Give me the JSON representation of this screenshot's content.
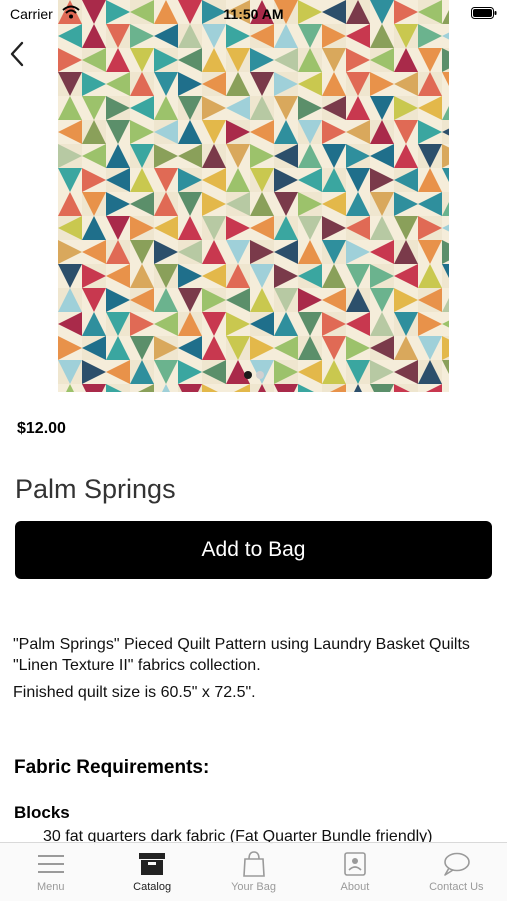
{
  "status_bar": {
    "carrier": "Carrier",
    "time": "11:50 AM"
  },
  "carousel": {
    "page_count": 2,
    "current_page": 1
  },
  "product": {
    "price": "$12.00",
    "title": "Palm Springs",
    "add_to_bag_label": "Add to Bag",
    "description": [
      "\"Palm Springs\" Pieced Quilt Pattern using Laundry Basket Quilts \"Linen Texture II\" fabrics collection.",
      "Finished quilt size is 60.5\" x 72.5\"."
    ],
    "fabric_requirements_heading": "Fabric Requirements:",
    "blocks_heading": "Blocks",
    "blocks_item": "30 fat quarters dark fabric (Fat Quarter Bundle friendly)"
  },
  "tab_bar": {
    "tabs": [
      {
        "label": "Menu",
        "icon": "menu-icon",
        "active": false
      },
      {
        "label": "Catalog",
        "icon": "catalog-box-icon",
        "active": true
      },
      {
        "label": "Your Bag",
        "icon": "shopping-bag-icon",
        "active": false
      },
      {
        "label": "About",
        "icon": "about-contact-card-icon",
        "active": false
      },
      {
        "label": "Contact Us",
        "icon": "speech-bubble-icon",
        "active": false
      }
    ]
  },
  "colors": {
    "button_bg": "#000000",
    "tab_active": "#222222",
    "tab_inactive": "#9a9a9a"
  }
}
